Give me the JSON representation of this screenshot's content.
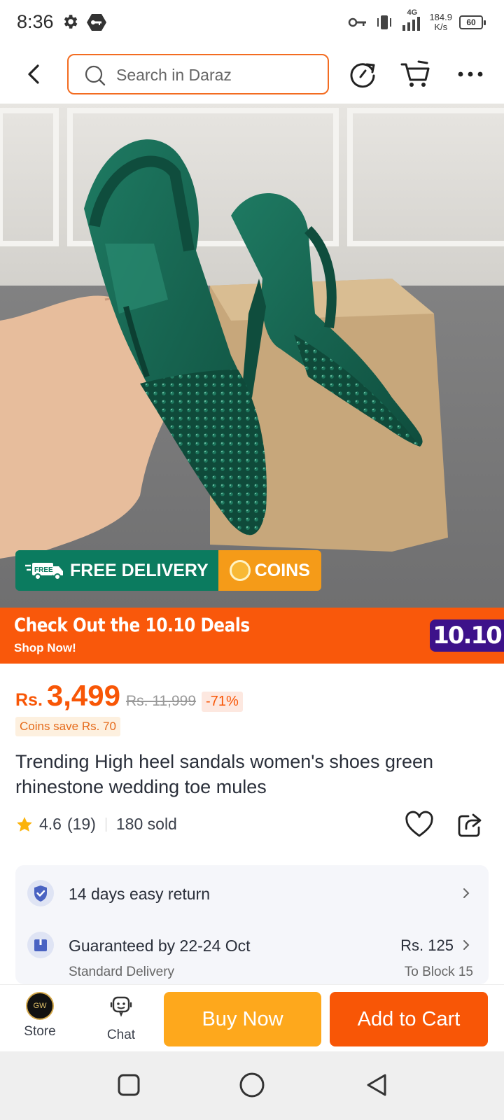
{
  "status_bar": {
    "time": "8:36",
    "network": "4G",
    "speed_value": "184.9",
    "speed_unit": "K/s",
    "battery": "60"
  },
  "header": {
    "search_placeholder": "Search in Daraz",
    "icons": [
      "back-arrow-icon",
      "refresh-icon",
      "cart-icon",
      "more-icon"
    ]
  },
  "hero": {
    "free_delivery_badge": "FREE",
    "free_delivery": "FREE DELIVERY",
    "coins": "COINS"
  },
  "deals_banner": {
    "title": "Check Out the 10.10 Deals",
    "subtitle": "Shop Now!",
    "badge": "10.10"
  },
  "product": {
    "currency": "Rs.",
    "price": "3,499",
    "original_price": "Rs. 11,999",
    "discount": "-71%",
    "coins_save": "Coins save Rs. 70",
    "title": "Trending High heel sandals women's shoes green rhinestone wedding toe mules",
    "rating": "4.6",
    "review_count": "(19)",
    "sold": "180 sold"
  },
  "services": {
    "return_label": "14 days easy return",
    "delivery_label": "Guaranteed by 22-24 Oct",
    "delivery_sub": "Standard Delivery",
    "delivery_price": "Rs. 125",
    "delivery_dest": "To Block 15"
  },
  "bottom_bar": {
    "store_label": "Store",
    "store_logo": "GW",
    "chat_label": "Chat",
    "buy_now": "Buy Now",
    "add_to_cart": "Add to Cart"
  },
  "colors": {
    "brand_orange": "#f85606",
    "buy_yellow": "#fea81c",
    "delivery_green": "#0b7b5f",
    "deals_badge_purple": "#3d128a"
  }
}
